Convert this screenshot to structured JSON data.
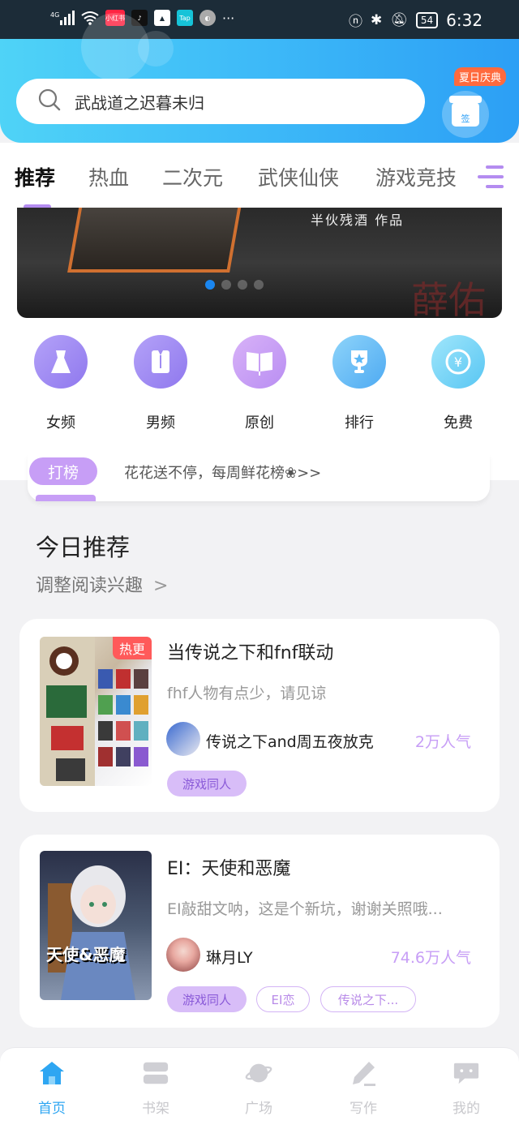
{
  "status_bar": {
    "network": "4G",
    "app_icons": [
      "小红书",
      "抖音",
      "相册",
      "Tap",
      "浏览器"
    ],
    "more": "···",
    "battery": "54",
    "time": "6:32"
  },
  "header": {
    "search_placeholder": "武战道之迟暮未归",
    "event_badge": "夏日庆典",
    "checkin_label": "签"
  },
  "tabs": [
    {
      "label": "推荐",
      "active": true
    },
    {
      "label": "热血",
      "active": false
    },
    {
      "label": "二次元",
      "active": false
    },
    {
      "label": "武侠仙侠",
      "active": false
    },
    {
      "label": "游戏竞技",
      "active": false
    }
  ],
  "banner": {
    "caption": "半伙残酒 作品",
    "active_index": 0,
    "count": 4
  },
  "categories": [
    {
      "label": "女频",
      "icon": "dress-icon",
      "color": "#a08cf2"
    },
    {
      "label": "男频",
      "icon": "shirt-icon",
      "color": "#a08cf2"
    },
    {
      "label": "原创",
      "icon": "book-icon",
      "color": "#c49af0"
    },
    {
      "label": "排行",
      "icon": "trophy-icon",
      "color": "#5cb8f5"
    },
    {
      "label": "免费",
      "icon": "coin-icon",
      "color": "#6fcff5"
    }
  ],
  "notice": {
    "tag": "打榜",
    "text": "花花送不停，每周鲜花榜❀>>"
  },
  "today": {
    "title": "今日推荐",
    "subtitle": "调整阅读兴趣",
    "chevron": ">"
  },
  "books": [
    {
      "title": "当传说之下和fnf联动",
      "desc": "fhf人物有点少，请见谅",
      "author": "传说之下and周五夜放克",
      "popularity": "2万人气",
      "badge": "热更",
      "tags": [
        "游戏同人"
      ]
    },
    {
      "title": "EI：天使和恶魔",
      "desc": "EI敲甜文呐，这是个新坑，谢谢关照哦...",
      "author": "琳月LY",
      "popularity": "74.6万人气",
      "badge": "",
      "cover_text": "天使&恶魔",
      "tags": [
        "游戏同人",
        "EI恋",
        "传说之下..."
      ]
    }
  ],
  "bottom_nav": [
    {
      "label": "首页",
      "icon": "home-icon",
      "active": true
    },
    {
      "label": "书架",
      "icon": "bookshelf-icon",
      "active": false
    },
    {
      "label": "广场",
      "icon": "planet-icon",
      "active": false
    },
    {
      "label": "写作",
      "icon": "pen-icon",
      "active": false
    },
    {
      "label": "我的",
      "icon": "chat-icon",
      "active": false
    }
  ],
  "colors": {
    "accent": "#b48cf0",
    "header_start": "#4fd3f7",
    "header_end": "#2c9ff5",
    "nav_active": "#2ea6f2"
  }
}
